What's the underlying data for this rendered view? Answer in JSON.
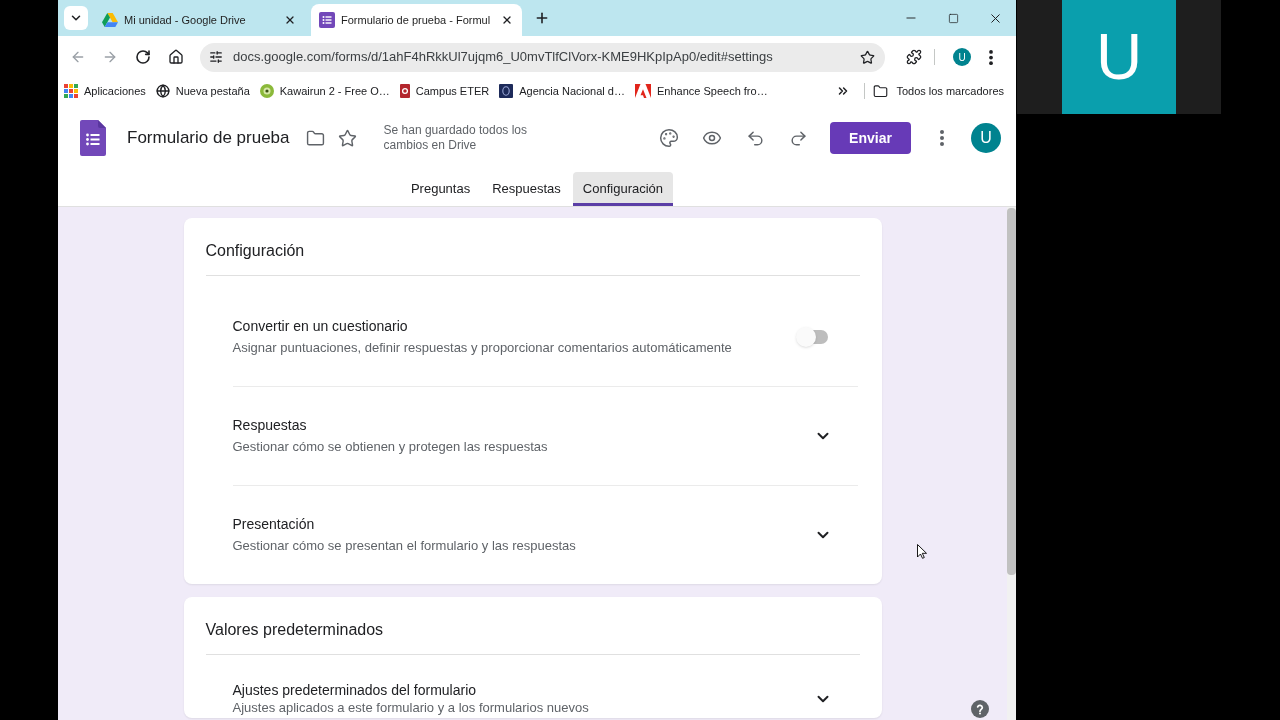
{
  "browser_tabs": [
    {
      "title": "Mi unidad - Google Drive",
      "selected": false
    },
    {
      "title": "Formulario de prueba - Formul",
      "selected": true
    }
  ],
  "address_bar": {
    "url": "docs.google.com/forms/d/1ahF4hRkkUl7ujqm6_U0mvTlfClVorx-KME9HKpIpAp0/edit#settings"
  },
  "browser_profile": {
    "initial": "U"
  },
  "bookmarks": [
    {
      "label": "Aplicaciones"
    },
    {
      "label": "Nueva pestaña"
    },
    {
      "label": "Kawairun 2 - Free O…"
    },
    {
      "label": "Campus ETER"
    },
    {
      "label": "Agencia Nacional d…"
    },
    {
      "label": "Enhance Speech fro…"
    }
  ],
  "all_bookmarks": {
    "label": "Todos los marcadores"
  },
  "form_header": {
    "title": "Formulario de prueba",
    "save_status": "Se han guardado todos los cambios en Drive",
    "send_button": "Enviar",
    "avatar_initial": "U"
  },
  "form_tabs": [
    {
      "label": "Preguntas",
      "selected": false
    },
    {
      "label": "Respuestas",
      "selected": false
    },
    {
      "label": "Configuración",
      "selected": true
    }
  ],
  "settings_card": {
    "title": "Configuración",
    "rows": [
      {
        "kind": "toggle",
        "title": "Convertir en un cuestionario",
        "description": "Asignar puntuaciones, definir respuestas y proporcionar comentarios automáticamente",
        "on": false
      },
      {
        "kind": "expand",
        "title": "Respuestas",
        "description": "Gestionar cómo se obtienen y protegen las respuestas"
      },
      {
        "kind": "expand",
        "title": "Presentación",
        "description": "Gestionar cómo se presentan el formulario y las respuestas"
      }
    ]
  },
  "defaults_card": {
    "title": "Valores predeterminados",
    "rows": [
      {
        "kind": "expand",
        "title": "Ajustes predeterminados del formulario",
        "description": "Ajustes aplicados a este formulario y a los formularios nuevos"
      }
    ]
  },
  "video_tile": {
    "initial": "U"
  }
}
